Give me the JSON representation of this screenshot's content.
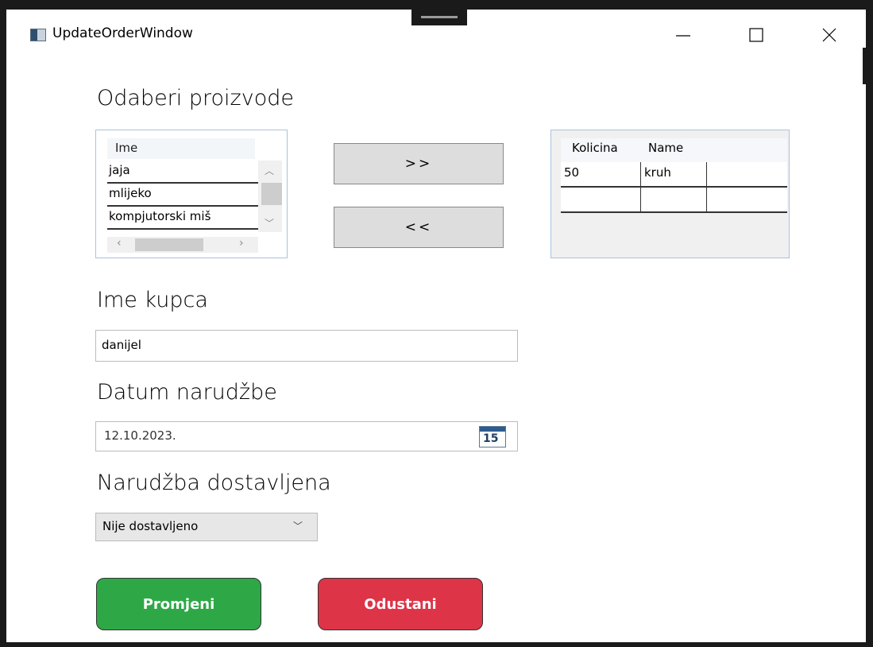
{
  "window": {
    "title": "UpdateOrderWindow",
    "controls": {
      "minimize": "—",
      "maximize": "☐",
      "close": "✕"
    }
  },
  "products_label": "Odaberi proizvode",
  "products_list": {
    "header": "Ime",
    "items": [
      "jaja",
      "mlijeko",
      "kompjutorski miš"
    ]
  },
  "buttons": {
    "add": ">>",
    "remove": "<<"
  },
  "order_grid": {
    "columns": [
      "Kolicina",
      "Name"
    ],
    "rows": [
      {
        "kolicina": "50",
        "name": "kruh"
      },
      {
        "kolicina": "",
        "name": ""
      }
    ]
  },
  "customer_label": "Ime kupca",
  "customer_value": "danijel",
  "date_label": "Datum narudžbe",
  "date_value": "12.10.2023.",
  "calendar_icon_text": "15",
  "delivered_label": "Narudžba dostavljena",
  "delivered_value": "Nije dostavljeno",
  "actions": {
    "save": "Promjeni",
    "cancel": "Odustani"
  },
  "colors": {
    "save": "#2ea846",
    "cancel": "#dd3447",
    "border_accent": "#a8c2de"
  },
  "icons": [
    "app-icon",
    "minimize-icon",
    "maximize-icon",
    "close-icon",
    "calendar-icon",
    "chevron-down-icon"
  ]
}
